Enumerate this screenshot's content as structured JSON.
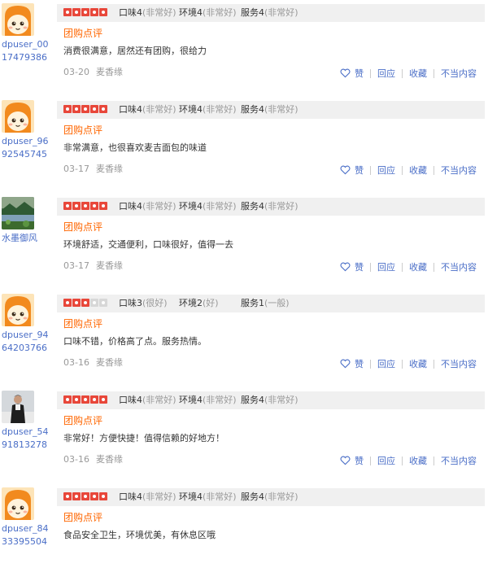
{
  "labels": {
    "taste": "口味",
    "environment": "环境",
    "service": "服务",
    "tag": "团购点评",
    "like": "赞",
    "reply": "回应",
    "favorite": "收藏",
    "report": "不当内容"
  },
  "reviews": [
    {
      "username": "dpuser_0017479386",
      "avatar": "cartoon-face",
      "stars": 5,
      "taste": "4",
      "taste_q": "(非常好)",
      "env": "4",
      "env_q": "(非常好)",
      "service": "4",
      "service_q": "(非常好)",
      "text": "消费很满意，居然还有团购，很给力",
      "date": "03-20",
      "shop": "麦香缘"
    },
    {
      "username": "dpuser_9692545745",
      "avatar": "cartoon-face",
      "stars": 5,
      "taste": "4",
      "taste_q": "(非常好)",
      "env": "4",
      "env_q": "(非常好)",
      "service": "4",
      "service_q": "(非常好)",
      "text": "非常满意，也很喜欢麦吉面包的味道",
      "date": "03-17",
      "shop": "麦香缘"
    },
    {
      "username": "水墨御风",
      "avatar": "landscape-photo",
      "stars": 5,
      "taste": "4",
      "taste_q": "(非常好)",
      "env": "4",
      "env_q": "(非常好)",
      "service": "4",
      "service_q": "(非常好)",
      "text": "环境舒适，交通便利，口味很好，值得一去",
      "date": "03-17",
      "shop": "麦香缘"
    },
    {
      "username": "dpuser_9464203766",
      "avatar": "cartoon-face",
      "stars": 3,
      "taste": "3",
      "taste_q": "(很好)",
      "env": "2",
      "env_q": "(好)",
      "service": "1",
      "service_q": "(一般)",
      "text": "口味不错，价格高了点。服务热情。",
      "date": "03-16",
      "shop": "麦香缘"
    },
    {
      "username": "dpuser_5491813278",
      "avatar": "person-photo",
      "stars": 5,
      "taste": "4",
      "taste_q": "(非常好)",
      "env": "4",
      "env_q": "(非常好)",
      "service": "4",
      "service_q": "(非常好)",
      "text": "非常好！方便快捷！值得信赖的好地方！",
      "date": "03-16",
      "shop": "麦香缘"
    },
    {
      "username": "dpuser_8433395504",
      "avatar": "cartoon-face",
      "stars": 5,
      "taste": "4",
      "taste_q": "(非常好)",
      "env": "4",
      "env_q": "(非常好)",
      "service": "4",
      "service_q": "(非常好)",
      "text": "食品安全卫生，环境优美，有休息区哦",
      "date": "",
      "shop": ""
    }
  ],
  "colors": {
    "star": "#e8473a",
    "tag": "#ff6600",
    "link": "#4a6ec7",
    "meta": "#999999",
    "bar": "#f0f0f0"
  }
}
